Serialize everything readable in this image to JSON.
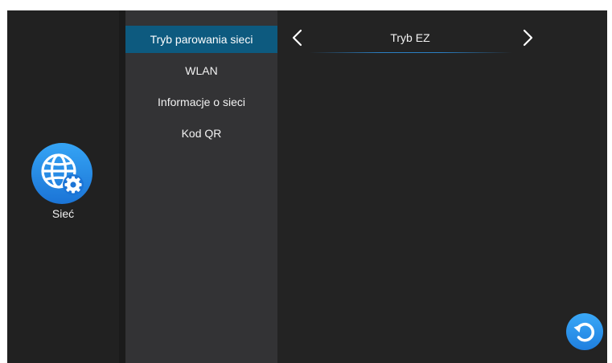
{
  "sidebar": {
    "section_label": "Sieć",
    "section_icon": "globe-gear-icon"
  },
  "menu": {
    "items": [
      {
        "label": "Tryb parowania sieci",
        "active": true
      },
      {
        "label": "WLAN",
        "active": false
      },
      {
        "label": "Informacje o sieci",
        "active": false
      },
      {
        "label": "Kod QR",
        "active": false
      }
    ]
  },
  "content": {
    "mode_value": "Tryb EZ",
    "prev_icon": "chevron-left-icon",
    "next_icon": "chevron-right-icon"
  },
  "footer": {
    "refresh_icon": "refresh-icon"
  },
  "colors": {
    "screen_bg": "#232323",
    "menu_bg": "#333335",
    "active_item_bg": "#0d5a7f",
    "accent_blue": "#2b8fe6"
  }
}
